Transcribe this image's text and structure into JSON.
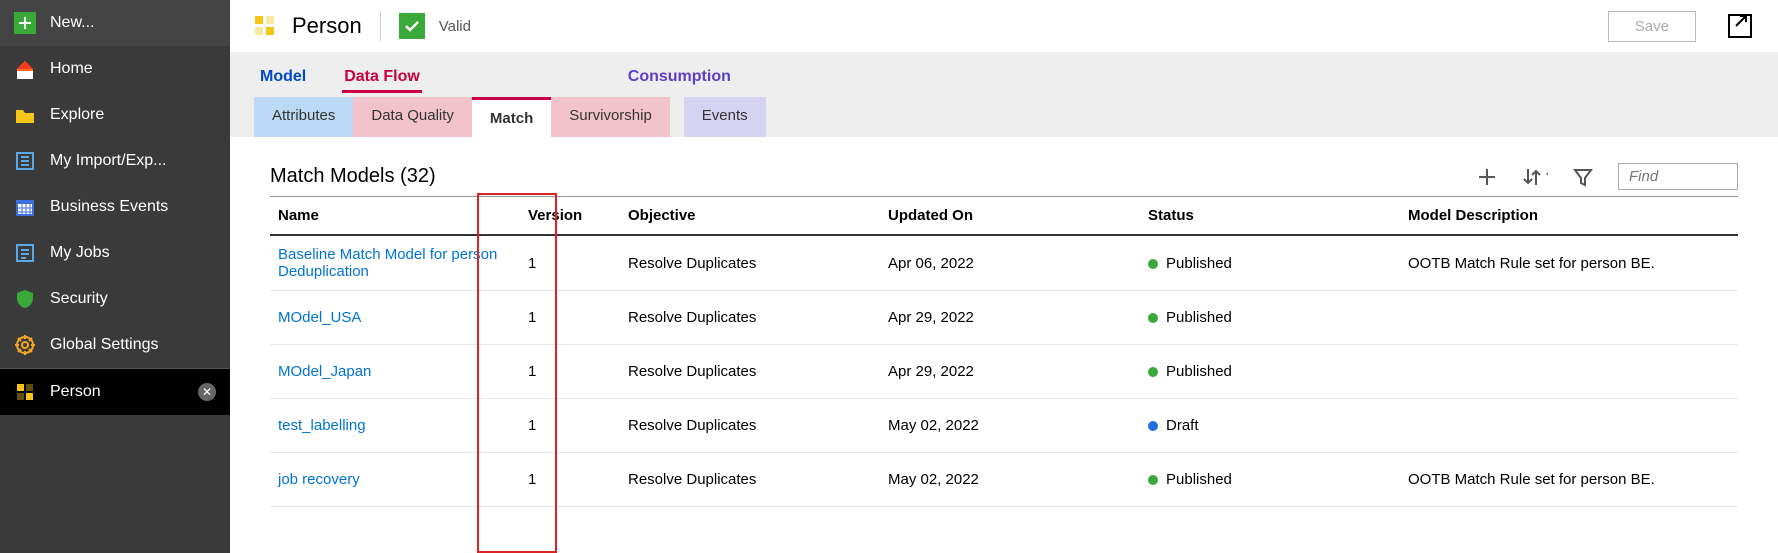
{
  "sidebar": {
    "items": [
      {
        "label": "New..."
      },
      {
        "label": "Home"
      },
      {
        "label": "Explore"
      },
      {
        "label": "My Import/Exp..."
      },
      {
        "label": "Business Events"
      },
      {
        "label": "My Jobs"
      },
      {
        "label": "Security"
      },
      {
        "label": "Global Settings"
      }
    ],
    "active": {
      "label": "Person"
    }
  },
  "header": {
    "title": "Person",
    "valid_label": "Valid",
    "save_label": "Save"
  },
  "tabs": {
    "model": "Model",
    "dataflow": "Data Flow",
    "consumption": "Consumption"
  },
  "subtabs": {
    "attributes": "Attributes",
    "dataquality": "Data Quality",
    "match": "Match",
    "survivor": "Survivorship",
    "events": "Events"
  },
  "list": {
    "title": "Match Models (32)",
    "find_placeholder": "Find"
  },
  "columns": {
    "name": "Name",
    "version": "Version",
    "objective": "Objective",
    "updated": "Updated On",
    "status": "Status",
    "desc": "Model Description"
  },
  "rows": [
    {
      "name": "Baseline Match Model for person Deduplication",
      "version": "1",
      "objective": "Resolve Duplicates",
      "updated": "Apr 06, 2022",
      "status": "Published",
      "status_type": "published",
      "desc": "OOTB Match Rule set for person BE."
    },
    {
      "name": "MOdel_USA",
      "version": "1",
      "objective": "Resolve Duplicates",
      "updated": "Apr 29, 2022",
      "status": "Published",
      "status_type": "published",
      "desc": ""
    },
    {
      "name": "MOdel_Japan",
      "version": "1",
      "objective": "Resolve Duplicates",
      "updated": "Apr 29, 2022",
      "status": "Published",
      "status_type": "published",
      "desc": ""
    },
    {
      "name": "test_labelling",
      "version": "1",
      "objective": "Resolve Duplicates",
      "updated": "May 02, 2022",
      "status": "Draft",
      "status_type": "draft",
      "desc": ""
    },
    {
      "name": "job recovery",
      "version": "1",
      "objective": "Resolve Duplicates",
      "updated": "May 02, 2022",
      "status": "Published",
      "status_type": "published",
      "desc": "OOTB Match Rule set for person BE."
    }
  ]
}
